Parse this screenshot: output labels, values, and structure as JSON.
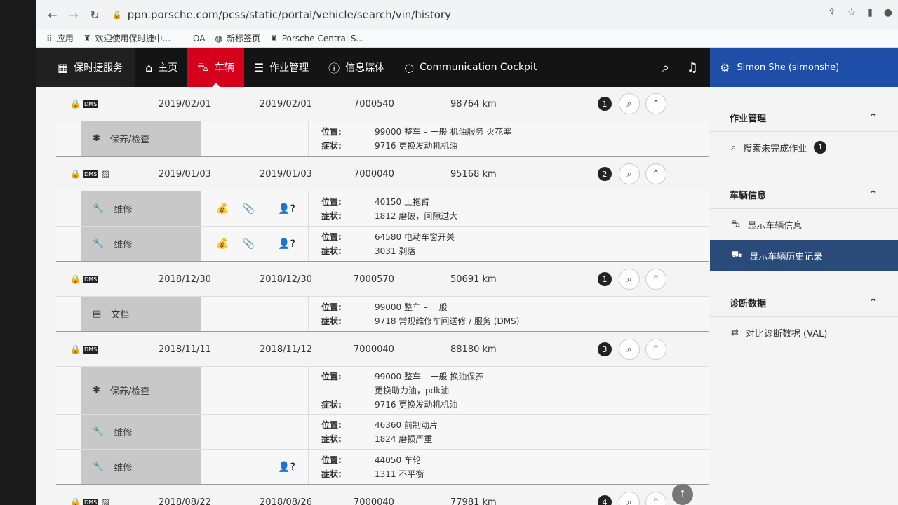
{
  "browser": {
    "url": "ppn.porsche.com/pcss/static/portal/vehicle/search/vin/history",
    "bookmarks": [
      {
        "label": "应用",
        "icon": "apps-grid-icon"
      },
      {
        "label": "欢迎使用保时捷中...",
        "icon": "porsche-crest-icon"
      },
      {
        "label": "OA",
        "icon": "dash-icon"
      },
      {
        "label": "新标签页",
        "icon": "globe-icon"
      },
      {
        "label": "Porsche Central S...",
        "icon": "porsche-crest-icon"
      }
    ]
  },
  "appbar": {
    "brand": "保时捷服务",
    "nav": [
      {
        "label": "主页",
        "icon": "home-icon"
      },
      {
        "label": "车辆",
        "icon": "car-icon",
        "active": true
      },
      {
        "label": "作业管理",
        "icon": "list-icon"
      },
      {
        "label": "信息媒体",
        "icon": "info-icon"
      },
      {
        "label": "Communication Cockpit",
        "icon": "chat-icon"
      }
    ],
    "user": "Simon She (simonshe)"
  },
  "labels": {
    "location": "位置:",
    "symptom": "症状:"
  },
  "records": [
    {
      "date_start": "2019/02/01",
      "date_end": "2019/02/01",
      "order_no": "7000540",
      "mileage": "98764 km",
      "count": "1",
      "has_doc": false,
      "jobs": [
        {
          "type": "保养/检查",
          "icon": "gear-icon",
          "location": [
            "99000 整车 – 一般   机油服务 火花塞"
          ],
          "symptom": "9716 更换发动机机油",
          "bag": false,
          "clip": false,
          "question": false
        }
      ]
    },
    {
      "date_start": "2019/01/03",
      "date_end": "2019/01/03",
      "order_no": "7000040",
      "mileage": "95168 km",
      "count": "2",
      "has_doc": true,
      "jobs": [
        {
          "type": "维修",
          "icon": "wrench-icon",
          "location": [
            "40150 上拖臂"
          ],
          "symptom": "1812 磨破，间隙过大",
          "bag": true,
          "clip": true,
          "question": true
        },
        {
          "type": "维修",
          "icon": "wrench-icon",
          "location": [
            "64580 电动车窗开关"
          ],
          "symptom": "3031 剥落",
          "bag": true,
          "clip": true,
          "question": true
        }
      ]
    },
    {
      "date_start": "2018/12/30",
      "date_end": "2018/12/30",
      "order_no": "7000570",
      "mileage": "50691 km",
      "count": "1",
      "has_doc": false,
      "jobs": [
        {
          "type": "文档",
          "icon": "document-icon",
          "location": [
            "99000 整车 – 一般"
          ],
          "symptom": "9718 常规维修车间送修 / 服务 (DMS)",
          "bag": false,
          "clip": false,
          "question": false
        }
      ]
    },
    {
      "date_start": "2018/11/11",
      "date_end": "2018/11/12",
      "order_no": "7000040",
      "mileage": "88180 km",
      "count": "3",
      "has_doc": false,
      "jobs": [
        {
          "type": "保养/检查",
          "icon": "gear-icon",
          "location": [
            "99000 整车 – 一般   换油保养",
            "更换助力油，pdk油"
          ],
          "symptom": "9716 更换发动机机油",
          "bag": false,
          "clip": false,
          "question": false
        },
        {
          "type": "维修",
          "icon": "wrench-icon",
          "location": [
            "46360 前制动片"
          ],
          "symptom": "1824 磨损严重",
          "bag": false,
          "clip": false,
          "question": false
        },
        {
          "type": "维修",
          "icon": "wrench-icon",
          "location": [
            "44050 车轮"
          ],
          "symptom": "1311 不平衡",
          "bag": false,
          "clip": false,
          "question": true
        }
      ]
    },
    {
      "date_start": "2018/08/22",
      "date_end": "2018/08/26",
      "order_no": "7000040",
      "mileage": "77981 km",
      "count": "4",
      "has_doc": true,
      "jobs": []
    }
  ],
  "sidebar": {
    "sections": [
      {
        "title": "作业管理",
        "items": [
          {
            "label": "搜索未完成作业",
            "icon": "search-icon",
            "badge": "1"
          }
        ]
      },
      {
        "title": "车辆信息",
        "items": [
          {
            "label": "显示车辆信息",
            "icon": "car-icon"
          },
          {
            "label": "显示车辆历史记录",
            "icon": "car-history-icon",
            "active": true
          }
        ]
      },
      {
        "title": "诊断数据",
        "items": [
          {
            "label": "对比诊断数据 (VAL)",
            "icon": "compare-icon"
          }
        ]
      }
    ]
  }
}
